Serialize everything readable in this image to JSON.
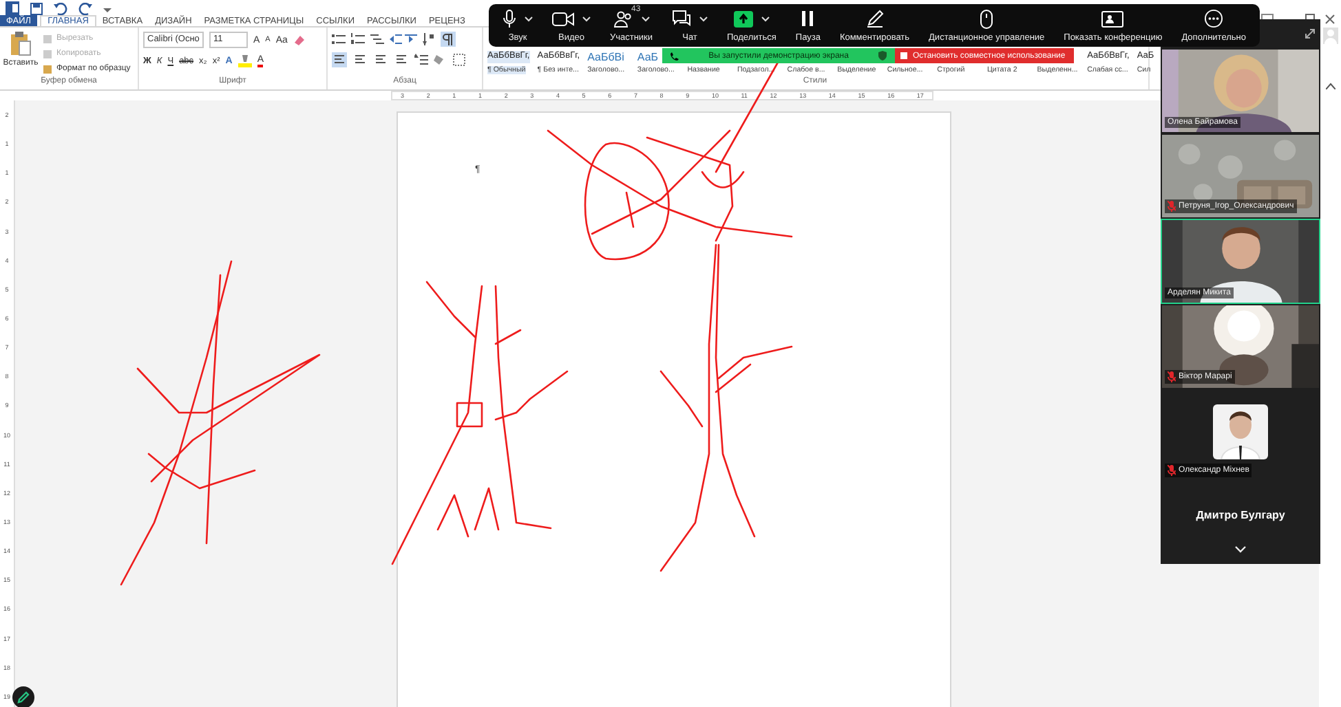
{
  "word": {
    "tabs": [
      {
        "label": "ФАЙЛ",
        "kind": "file",
        "selected": false
      },
      {
        "label": "ГЛАВНАЯ",
        "kind": "tab",
        "selected": true
      },
      {
        "label": "ВСТАВКА",
        "kind": "tab",
        "selected": false
      },
      {
        "label": "ДИЗАЙН",
        "kind": "tab",
        "selected": false
      },
      {
        "label": "РАЗМЕТКА СТРАНИЦЫ",
        "kind": "tab",
        "selected": false
      },
      {
        "label": "ССЫЛКИ",
        "kind": "tab",
        "selected": false
      },
      {
        "label": "РАССЫЛКИ",
        "kind": "tab",
        "selected": false
      },
      {
        "label": "РЕЦЕНЗ",
        "kind": "tab",
        "selected": false
      }
    ],
    "clipboard": {
      "paste": "Вставить",
      "group_label": "Буфер обмена",
      "items": [
        {
          "label": "Вырезать",
          "disabled": true
        },
        {
          "label": "Копировать",
          "disabled": true
        },
        {
          "label": "Формат по образцу",
          "disabled": false
        }
      ]
    },
    "font": {
      "family": "Calibri (Осно",
      "size": "11",
      "grow": "A",
      "shrink": "A",
      "change_case": "Aa",
      "format_buttons": [
        "Ж",
        "К",
        "Ч",
        "abc",
        "x₂",
        "x²"
      ],
      "effects": "A",
      "color_button": "A",
      "group_label": "Шрифт"
    },
    "paragraph": {
      "group_label": "Абзац",
      "show_marks": {
        "selected": true
      },
      "align_buttons": [
        {
          "selected": true
        },
        {
          "selected": false
        },
        {
          "selected": false
        },
        {
          "selected": false
        }
      ]
    },
    "styles": {
      "group_label": "Стили",
      "items": [
        {
          "sample": "АаБбВвГг,",
          "name": "¶ Обычный",
          "selected": true
        },
        {
          "sample": "АаБбВвГг,",
          "name": "¶ Без инте...",
          "selected": false
        },
        {
          "sample": "АаБбВі",
          "name": "Заголово...",
          "selected": false
        },
        {
          "sample": "АаБ",
          "name": "Заголово...",
          "selected": false
        },
        {
          "name": "Название",
          "selected": false
        },
        {
          "name": "Подзагол...",
          "selected": false
        },
        {
          "name": "Слабое в...",
          "selected": false
        },
        {
          "name": "Выделение",
          "selected": false
        },
        {
          "name": "Сильное...",
          "selected": false
        },
        {
          "name": "Строгий",
          "selected": false
        },
        {
          "name": "Цитата 2",
          "selected": false
        },
        {
          "name": "Выделенн...",
          "selected": false
        },
        {
          "sample": "АаБбВвГг,",
          "name": "Слабая сс...",
          "selected": false
        },
        {
          "sample": "АаБ",
          "name": "Сил",
          "selected": false
        }
      ]
    },
    "ruler": {
      "h_marks": [
        "3",
        "2",
        "1",
        "1",
        "2",
        "3",
        "4",
        "5",
        "6",
        "7",
        "8",
        "9",
        "10",
        "11",
        "12",
        "13",
        "14",
        "15",
        "16",
        "17"
      ],
      "v_marks": [
        "2",
        "1",
        "1",
        "2",
        "3",
        "4",
        "5",
        "6",
        "7",
        "8",
        "9",
        "10",
        "11",
        "12",
        "13",
        "14",
        "15",
        "16",
        "17",
        "18",
        "19"
      ]
    },
    "page": {
      "paragraph_mark": "¶"
    }
  },
  "zoom": {
    "toolbar": [
      {
        "label": "Звук",
        "kind": "mic",
        "caret": true
      },
      {
        "label": "Видео",
        "kind": "camera",
        "caret": true
      },
      {
        "label": "Участники",
        "kind": "people",
        "caret": true,
        "count": "43"
      },
      {
        "label": "Чат",
        "kind": "chat",
        "caret": true
      },
      {
        "label": "Поделиться",
        "kind": "share",
        "caret": true
      },
      {
        "label": "Пауза",
        "kind": "pause",
        "caret": false
      },
      {
        "label": "Комментировать",
        "kind": "pen",
        "caret": false
      },
      {
        "label": "Дистанционное управление",
        "kind": "mouse",
        "caret": false
      },
      {
        "label": "Показать конференцию",
        "kind": "screen",
        "caret": false
      },
      {
        "label": "Дополнительно",
        "kind": "more",
        "caret": false
      }
    ],
    "sharing_banner": "Вы запустили демонстрацию экрана",
    "stop_button": "Остановить совместное использование",
    "participants": [
      {
        "name": "Олена Байрамова",
        "kind": "video",
        "muted": false,
        "active": false
      },
      {
        "name": "Петруня_Ігор_Олександрович",
        "kind": "video",
        "muted": true,
        "active": false
      },
      {
        "name": "Арделян Микита",
        "kind": "video",
        "muted": false,
        "active": true
      },
      {
        "name": "Віктор Марарі",
        "kind": "video",
        "muted": true,
        "active": false
      },
      {
        "name": "Олександр Міхнев",
        "muted": true,
        "active": false
      },
      {
        "name": "Дмитро Булгару",
        "kind": "name",
        "muted": false,
        "active": false
      }
    ]
  }
}
